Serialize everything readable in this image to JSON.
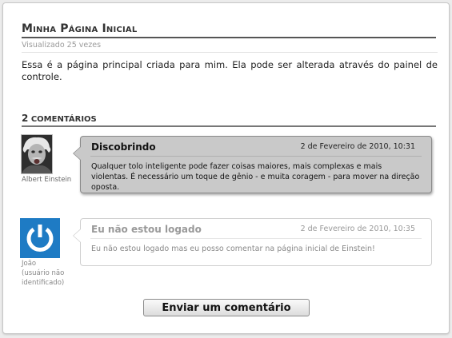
{
  "page": {
    "title": "Minha Página Inicial",
    "views": "Visualizado 25 vezes",
    "intro": "Essa é a página principal criada para mim. Ela pode ser alterada através do painel de controle."
  },
  "comments_section": {
    "count": "2",
    "label": "COMENTÁRIOS"
  },
  "comments": [
    {
      "author": "Albert Einstein",
      "title": "Discobrindo",
      "date": "2 de Fevereiro de 2010, 10:31",
      "body": "Qualquer tolo inteligente pode fazer coisas maiores, mais complexas e mais violentas. É necessário um toque de gênio - e muita coragem - para mover na direção oposta.",
      "highlighted": true
    },
    {
      "author_line1": "João",
      "author_line2": "(usuário não",
      "author_line3": "identificado)",
      "title": "Eu não estou logado",
      "date": "2 de Fevereiro de 2010, 10:35",
      "body": "Eu não estou logado mas eu posso comentar na página inicial de Einstein!",
      "highlighted": false
    }
  ],
  "actions": {
    "submit_label": "Enviar um comentário"
  },
  "colors": {
    "highlight_bubble": "#c9c9c9",
    "guest_avatar": "#1e7bc4"
  },
  "icons": {
    "guest_avatar": "power-icon",
    "einstein_avatar": "portrait-photo"
  }
}
